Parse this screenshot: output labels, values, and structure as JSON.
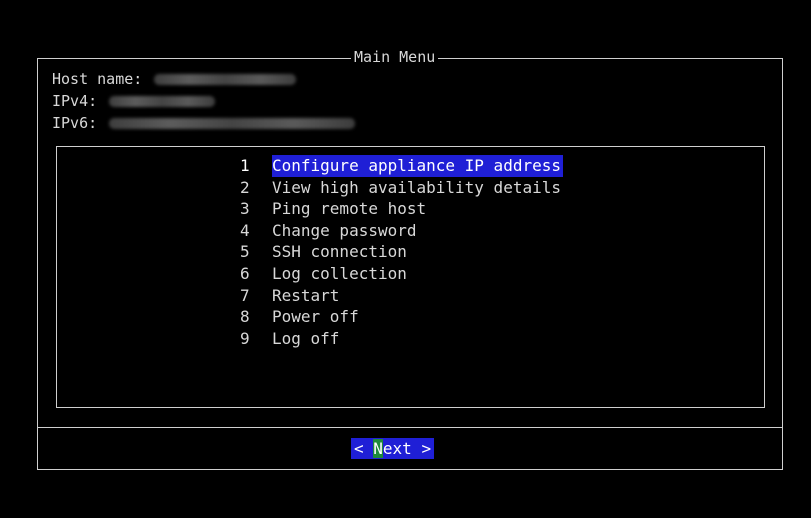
{
  "window": {
    "title": "Main Menu"
  },
  "host": {
    "hostname_label": "Host name:",
    "ipv4_label": "IPv4:",
    "ipv6_label": "IPv6:"
  },
  "menu": {
    "items": [
      {
        "num": "1",
        "label": "Configure appliance IP address"
      },
      {
        "num": "2",
        "label": "View high availability details"
      },
      {
        "num": "3",
        "label": "Ping remote host"
      },
      {
        "num": "4",
        "label": "Change password"
      },
      {
        "num": "5",
        "label": "SSH connection"
      },
      {
        "num": "6",
        "label": "Log collection"
      },
      {
        "num": "7",
        "label": "Restart"
      },
      {
        "num": "8",
        "label": "Power off"
      },
      {
        "num": "9",
        "label": "Log off"
      }
    ],
    "selected": "1"
  },
  "footer": {
    "next_prefix": "< ",
    "next_hotkey": "N",
    "next_rest": "ext >"
  },
  "colors": {
    "background": "#000000",
    "text": "#d8d8d8",
    "highlight": "#1f1fd6",
    "hotkey": "#1e8a3a"
  }
}
